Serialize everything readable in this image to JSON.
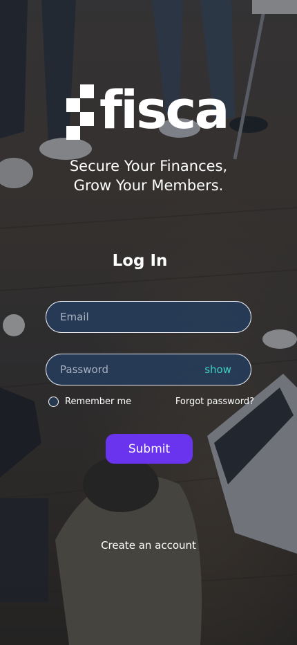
{
  "brand": {
    "name": "fisca",
    "tagline_line1": "Secure Your Finances,",
    "tagline_line2": "Grow Your Members."
  },
  "login": {
    "title": "Log In",
    "email_placeholder": "Email",
    "password_placeholder": "Password",
    "show_label": "show",
    "remember_label": "Remember me",
    "remember_checked": false,
    "forgot_label": "Forgot password?",
    "submit_label": "Submit",
    "create_account_label": "Create an account"
  },
  "colors": {
    "accent_button": "#6a33ee",
    "show_link": "#3ed3c4",
    "input_fill": "#253d5c",
    "text": "#ffffff"
  }
}
